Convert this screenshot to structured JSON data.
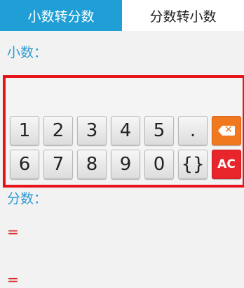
{
  "tabs": [
    {
      "label": "小数转分数"
    },
    {
      "label": "分数转小数"
    }
  ],
  "labels": {
    "decimal": "小数：",
    "fraction": "分数："
  },
  "keypad": {
    "row1": [
      "1",
      "2",
      "3",
      "4",
      "5",
      "."
    ],
    "row2": [
      "6",
      "7",
      "8",
      "9",
      "0",
      "{}"
    ],
    "backspace_icon": "backspace-icon",
    "clear_label": "AC"
  },
  "result": {
    "eq1": "=",
    "eq2": "="
  },
  "colors": {
    "accent": "#1f9fd6",
    "highlight_border": "#e8141c",
    "backspace": "#f0791f",
    "clear": "#e8252b",
    "equals": "#d9262b"
  }
}
